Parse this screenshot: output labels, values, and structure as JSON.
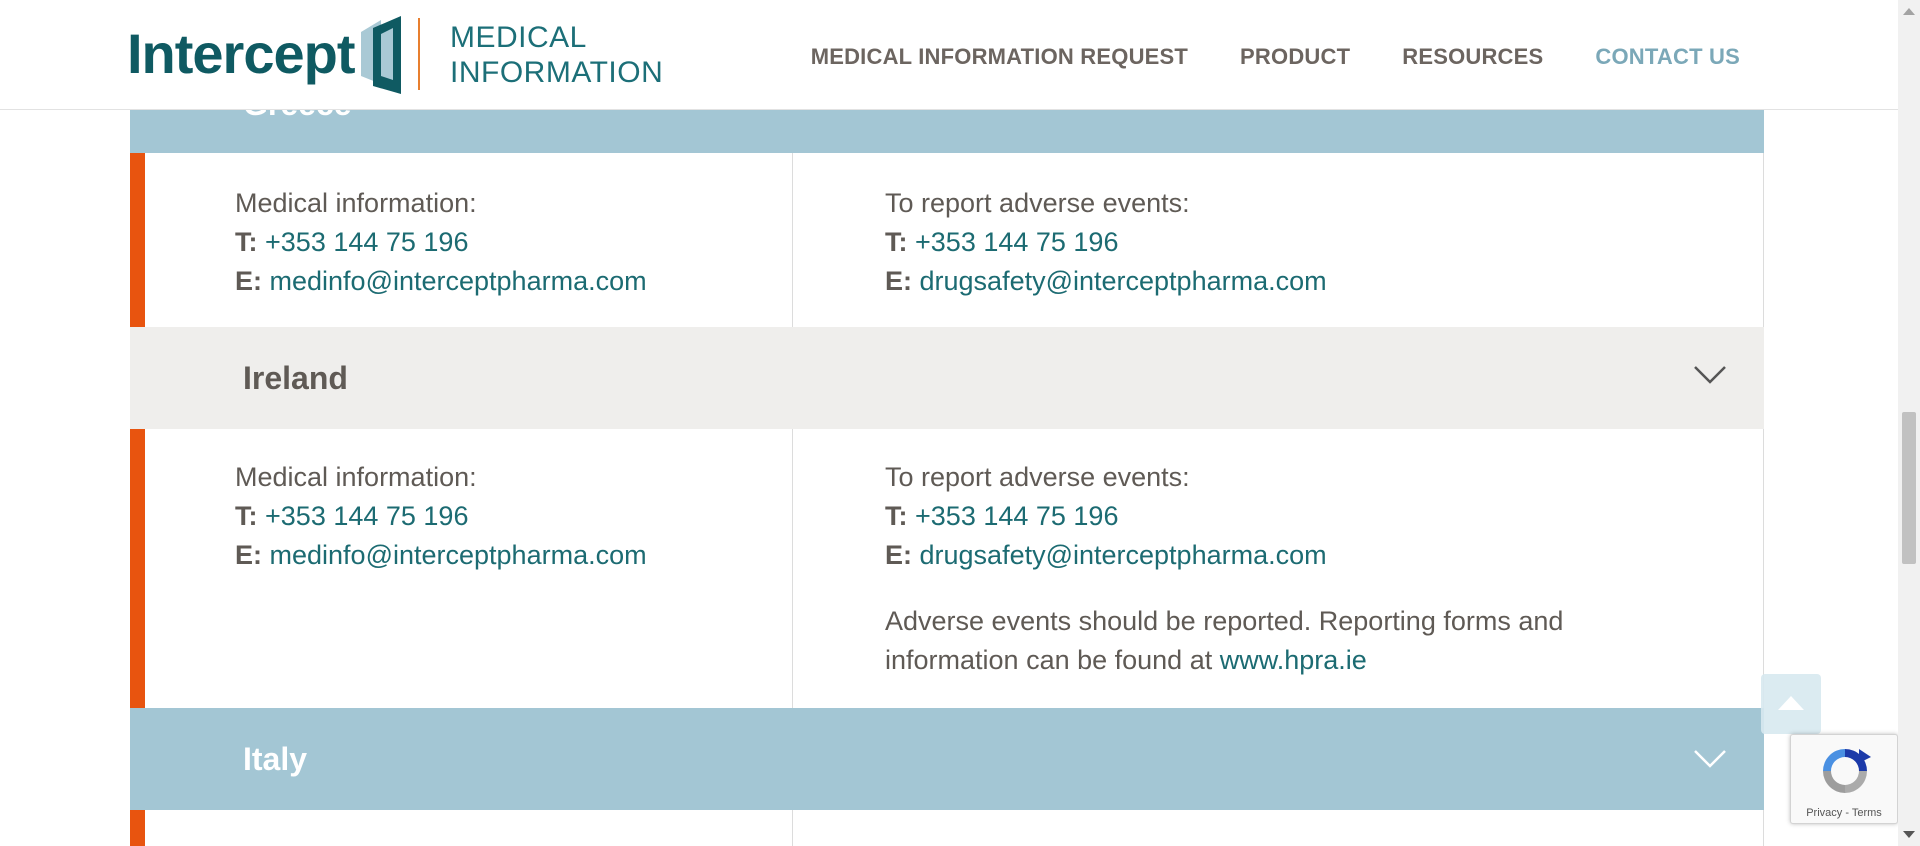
{
  "header": {
    "logo_text": "Intercept",
    "logo_sub_line1": "MEDICAL",
    "logo_sub_line2": "INFORMATION",
    "nav": [
      {
        "label": "MEDICAL INFORMATION REQUEST"
      },
      {
        "label": "PRODUCT"
      },
      {
        "label": "RESOURCES"
      },
      {
        "label": "CONTACT US"
      }
    ]
  },
  "sections": [
    {
      "country": "Greece",
      "medical": {
        "heading": "Medical information:",
        "t_label": "T:",
        "phone": "+353 144 75 196",
        "e_label": "E:",
        "email": "medinfo@interceptpharma.com"
      },
      "adverse": {
        "heading": "To report adverse events:",
        "t_label": "T:",
        "phone": "+353 144 75 196",
        "e_label": "E:",
        "email": "drugsafety@interceptpharma.com"
      }
    },
    {
      "country": "Ireland",
      "medical": {
        "heading": "Medical information:",
        "t_label": "T:",
        "phone": "+353 144 75 196",
        "e_label": "E:",
        "email": "medinfo@interceptpharma.com"
      },
      "adverse": {
        "heading": "To report adverse events:",
        "t_label": "T:",
        "phone": "+353 144 75 196",
        "e_label": "E:",
        "email": "drugsafety@interceptpharma.com",
        "note_line1": "Adverse events should be reported. Reporting forms and",
        "note_line2_prefix": "information can be found at",
        "note_link": "www.hpra.ie"
      }
    },
    {
      "country": "Italy"
    }
  ],
  "recaptcha": {
    "privacy": "Privacy",
    "separator": "-",
    "terms": "Terms"
  },
  "colors": {
    "brand_teal": "#0f5a62",
    "accent_orange": "#e8540f",
    "header_blue": "#a3c6d4",
    "header_grey": "#efeeec"
  }
}
